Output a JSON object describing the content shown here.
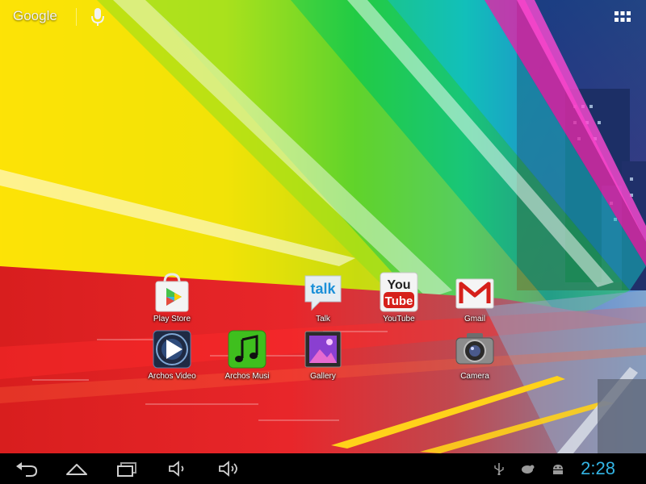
{
  "search_bar": {
    "google_label": "Google",
    "mic_icon": "microphone-icon",
    "apps_icon": "all-apps-grid-icon"
  },
  "home_apps": [
    {
      "label": "Play Store",
      "icon": "play-store-icon"
    },
    {
      "label": "Talk",
      "icon": "talk-icon"
    },
    {
      "label": "YouTube",
      "icon": "youtube-icon"
    },
    {
      "label": "Gmail",
      "icon": "gmail-icon"
    },
    {
      "label": "Archos Video",
      "icon": "archos-video-icon"
    },
    {
      "label": "Archos Musi",
      "icon": "archos-music-icon"
    },
    {
      "label": "Gallery",
      "icon": "gallery-icon"
    },
    {
      "label": "Camera",
      "icon": "camera-icon"
    }
  ],
  "icon_text": {
    "talk": "talk",
    "youtube_you": "You",
    "youtube_tube": "Tube"
  },
  "system_bar": {
    "clock": "2:28",
    "nav_buttons": [
      "back-icon",
      "home-icon",
      "recent-apps-icon",
      "volume-down-icon",
      "volume-up-icon"
    ],
    "status_icons": [
      "usb-icon",
      "notification-icon",
      "android-debug-icon"
    ]
  },
  "colors": {
    "clock": "#33b5e5",
    "system_bar": "#000000"
  }
}
